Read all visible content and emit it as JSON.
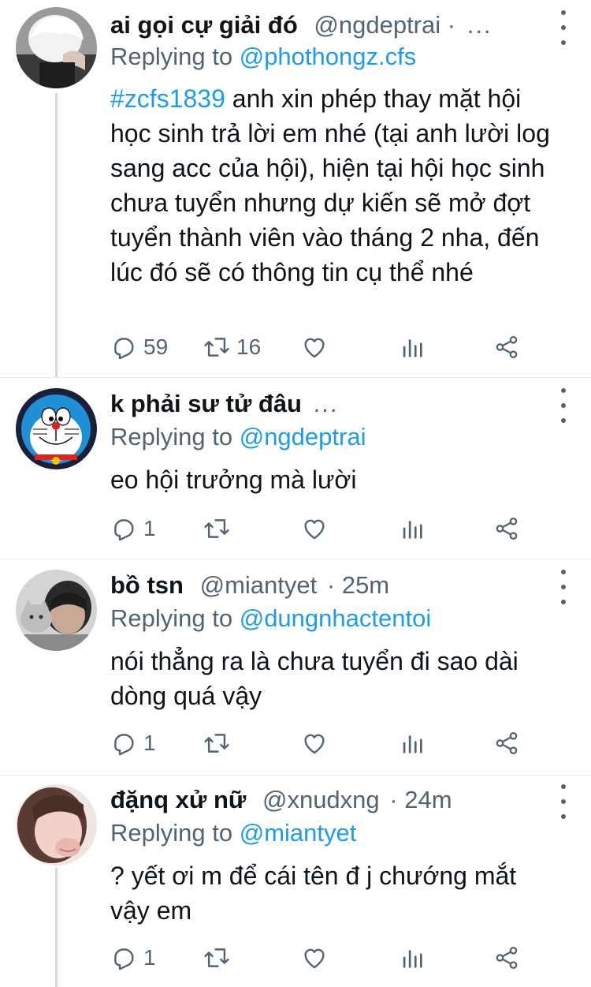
{
  "replies": [
    {
      "name": "ai gọi cự giải đó",
      "handle": "@ngdeptrai ·",
      "time": "",
      "truncated": "...",
      "replying_label": "Replying to",
      "replying_to": "@phothongz.cfs",
      "hashtag": "#zcfs1839",
      "text": "anh xin phép thay mặt hội học sinh trả lời em nhé (tại anh lười log sang acc của hội), hiện tại hội học sinh chưa tuyển nhưng dự kiến sẽ mở đợt tuyển thành viên vào tháng 2 nha, đến lúc đó sẽ có thông tin cụ thể nhé",
      "reply_count": "59",
      "retweet_count": "16",
      "avatar": "white-haired-person-photo"
    },
    {
      "name": "k phải sư tử đâu",
      "handle": "",
      "time": "",
      "truncated": "...",
      "replying_label": "Replying to",
      "replying_to": "@ngdeptrai",
      "hashtag": "",
      "text": "eo hội trưởng mà lười",
      "reply_count": "1",
      "retweet_count": "",
      "avatar": "doraemon-cartoon"
    },
    {
      "name": "bồ tsn",
      "handle": "@miantyet",
      "time": "· 25m",
      "truncated": "",
      "replying_label": "Replying to",
      "replying_to": "@dungnhactentoi",
      "hashtag": "",
      "text": "nói thẳng ra là chưa tuyển đi sao dài dòng quá vậy",
      "reply_count": "1",
      "retweet_count": "",
      "avatar": "person-with-cat-photo"
    },
    {
      "name": "đặnq xử nữ",
      "handle": "@xnudxng",
      "time": "· 24m",
      "truncated": "",
      "replying_label": "Replying to",
      "replying_to": "@miantyet",
      "hashtag": "",
      "text": "? yết ơi m để cái tên đ j chướng mắt vậy em",
      "reply_count": "1",
      "retweet_count": "",
      "avatar": "girl-selfie-photo"
    }
  ],
  "colors": {
    "text": "#0f1419",
    "secondary": "#536471",
    "link": "#1d9bf0",
    "thread_line": "#cfd9de"
  },
  "icons": [
    "reply-icon",
    "retweet-icon",
    "like-icon",
    "analytics-icon",
    "share-icon",
    "more-options-icon"
  ]
}
